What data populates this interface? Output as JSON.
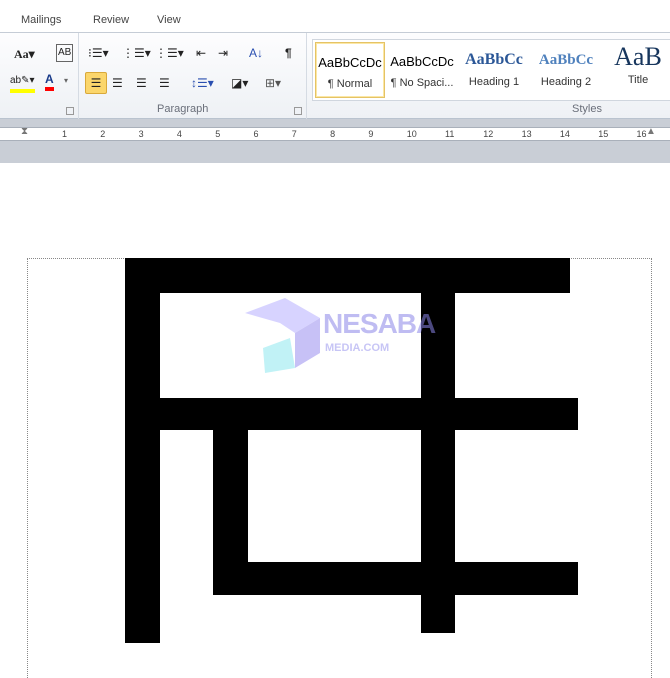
{
  "tabs": [
    "Mailings",
    "Review",
    "View"
  ],
  "groups": {
    "paragraph": "Paragraph",
    "styles": "Styles"
  },
  "icons": [
    "change-case-icon",
    "clear-formatting-icon",
    "bullets-icon",
    "numbering-icon",
    "multilevel-list-icon",
    "decrease-indent-icon",
    "increase-indent-icon",
    "sort-icon",
    "show-formatting-icon",
    "highlight-icon",
    "font-color-icon",
    "align-left-icon",
    "center-icon",
    "align-right-icon",
    "justify-icon",
    "line-spacing-icon",
    "shading-icon",
    "borders-icon"
  ],
  "colors": {
    "highlight": "#ffff00",
    "font_color": "#ff0000",
    "selected": "#fbd66b"
  },
  "styles": [
    {
      "sample": "AaBbCcDc",
      "label": "¶ Normal"
    },
    {
      "sample": "AaBbCcDc",
      "label": "¶ No Spaci..."
    },
    {
      "sample": "AaBbCc",
      "label": "Heading 1"
    },
    {
      "sample": "AaBbCc",
      "label": "Heading 2"
    },
    {
      "sample": "AaB",
      "label": "Title"
    }
  ],
  "ruler": [
    "1",
    "2",
    "3",
    "4",
    "5",
    "6",
    "7",
    "8",
    "9",
    "10",
    "11",
    "12",
    "13",
    "14",
    "15",
    "16"
  ],
  "watermark": {
    "line1": "NESABA",
    "line2": "MEDIA.COM"
  }
}
